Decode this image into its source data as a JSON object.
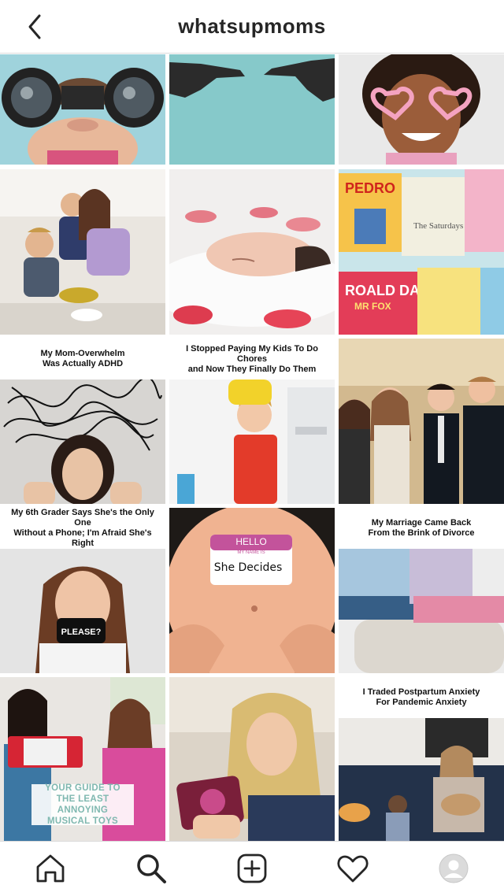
{
  "header": {
    "title": "whatsupmoms"
  },
  "posts": [
    {
      "caption": ""
    },
    {
      "caption": ""
    },
    {
      "caption": ""
    },
    {
      "caption": ""
    },
    {
      "caption": ""
    },
    {
      "caption": ""
    },
    {
      "caption": "My Mom-Overwhelm\nWas Actually ADHD"
    },
    {
      "caption": "I Stopped Paying My Kids To Do Chores\nand Now They Finally Do Them"
    },
    {
      "caption": ""
    },
    {
      "caption": "My 6th Grader Says She's the Only One\nWithout a Phone; I'm Afraid She's Right",
      "sign_text": "PLEASE?"
    },
    {
      "caption": "",
      "tag_title": "HELLO",
      "tag_sub": "MY NAME IS",
      "tag_text": "She Decides"
    },
    {
      "caption": "My Marriage Came Back\nFrom the Brink of Divorce"
    },
    {
      "caption": "",
      "overlay_text": "YOUR GUIDE TO\nTHE LEAST ANNOYING\nMUSICAL TOYS"
    },
    {
      "caption": ""
    },
    {
      "caption": "I Traded Postpartum Anxiety\nFor Pandemic Anxiety"
    }
  ],
  "book_titles": {
    "b1": "PEDRO",
    "b2": "The Saturdays",
    "b3": "ROALD DAHL",
    "b4": "MR FOX"
  },
  "tabs": [
    "home-icon",
    "search-icon",
    "add-post-icon",
    "heart-icon",
    "profile-avatar"
  ]
}
